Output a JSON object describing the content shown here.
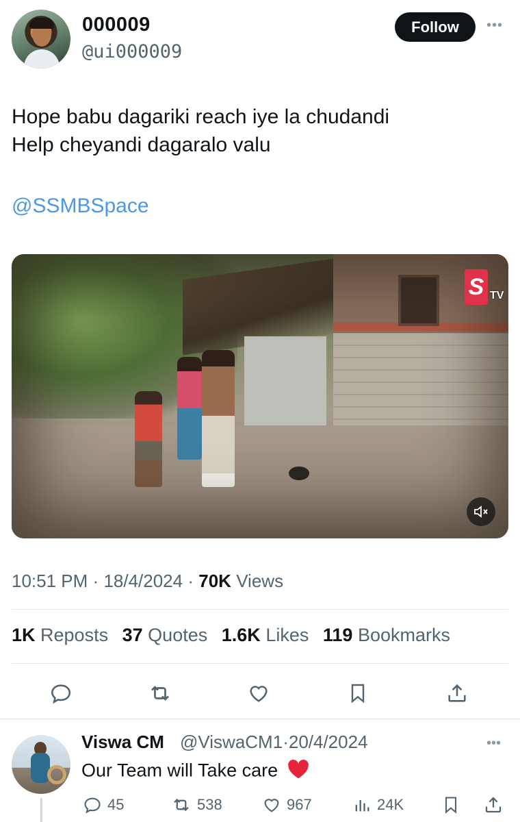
{
  "post": {
    "display_name": "000009",
    "handle": "@ui000009",
    "follow_label": "Follow",
    "more_label": "•••",
    "text_lines": [
      "Hope babu dagariki reach iye la chudandi",
      "Help cheyandi dagaralo valu"
    ],
    "mention": "@SSMBSpace",
    "media": {
      "logo_letter": "S",
      "logo_suffix": "TV",
      "mute_icon": "volume-mute-icon"
    },
    "time": "10:51 PM",
    "dot": "·",
    "date": "18/4/2024",
    "views_count": "70K",
    "views_label": "Views",
    "stats": [
      {
        "count": "1K",
        "label": "Reposts"
      },
      {
        "count": "37",
        "label": "Quotes"
      },
      {
        "count": "1.6K",
        "label": "Likes"
      },
      {
        "count": "119",
        "label": "Bookmarks"
      }
    ],
    "actions": [
      "reply-icon",
      "repost-icon",
      "like-icon",
      "bookmark-icon",
      "share-icon"
    ]
  },
  "reply": {
    "display_name": "Viswa CM",
    "handle": "@ViswaCM1",
    "dot": "·",
    "date": "20/4/2024",
    "more_label": "•••",
    "text": "Our Team will Take care",
    "emoji_icon": "red-heart-emoji",
    "counts": {
      "replies": "45",
      "reposts": "538",
      "likes": "967",
      "views": "24K"
    }
  },
  "colors": {
    "link": "#4a99e9",
    "muted": "#536471",
    "text": "#0f1419",
    "heart": "#e8243b"
  }
}
